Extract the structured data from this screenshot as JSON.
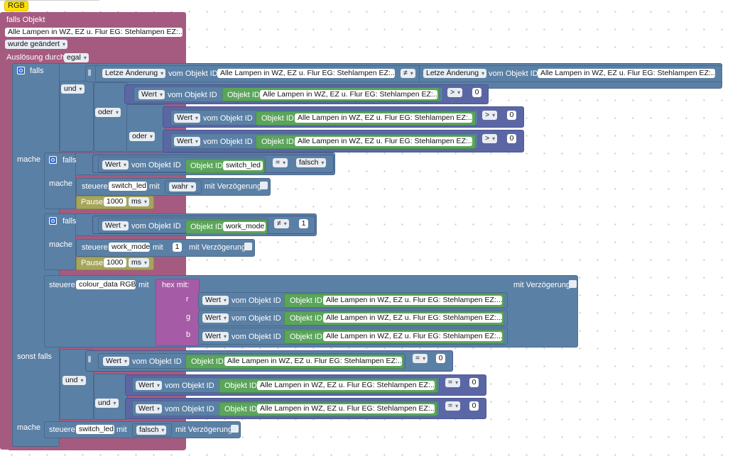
{
  "tab": "RGB",
  "trigger": {
    "title": "falls Objekt",
    "object": "Alle Lampen in WZ, EZ u. Flur EG: Stehlampen EZ:...",
    "changed": "wurde geändert",
    "trigger_by": "Auslösung durch",
    "trigger_value": "egal"
  },
  "labels": {
    "falls": "falls",
    "und": "und",
    "oder": "oder",
    "mache": "mache",
    "sonst_falls": "sonst falls",
    "vom_objekt_id": "vom Objekt ID",
    "objekt_id": "Objekt ID",
    "wert": "Wert",
    "letzte_aenderung": "Letze Änderung",
    "steuere": "steuere",
    "mit": "mit",
    "mit_verzoegerung": "mit Verzögerung",
    "pause": "Pause",
    "ms": "ms",
    "hex_mit": "hex  mit:",
    "r": "r",
    "g": "g",
    "b": "b"
  },
  "values": {
    "obj": "Alle Lampen in WZ, EZ u. Flur EG: Stehlampen EZ:...",
    "neq": "≠",
    "gt": ">",
    "eq": "=",
    "zero": "0",
    "one": "1",
    "switch_led": "switch_led",
    "work_mode": "work_mode",
    "colour_data": "colour_data RGB",
    "falsch": "falsch",
    "wahr": "wahr",
    "pause_1000": "1000"
  }
}
